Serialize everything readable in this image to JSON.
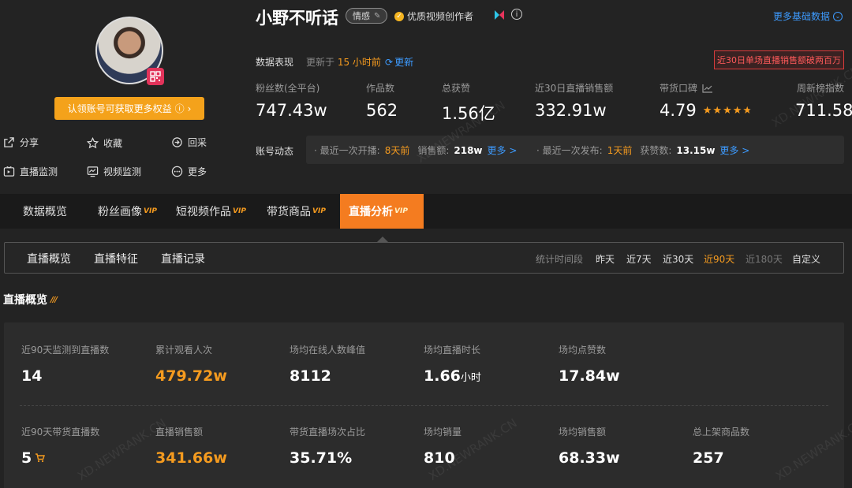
{
  "profile": {
    "name": "小野不听话",
    "tag": "情感",
    "creator_badge": "优质视频创作者",
    "more_basic_data": "更多基础数据",
    "claim_button": "认领账号可获取更多权益",
    "actions": [
      {
        "label": "分享",
        "icon": "share-icon"
      },
      {
        "label": "收藏",
        "icon": "star-outline-icon"
      },
      {
        "label": "回采",
        "icon": "refresh-icon"
      },
      {
        "label": "直播监测",
        "icon": "live-monitor-icon"
      },
      {
        "label": "视频监测",
        "icon": "video-monitor-icon"
      },
      {
        "label": "更多",
        "icon": "more-icon"
      }
    ]
  },
  "performance": {
    "label": "数据表现",
    "updated_prefix": "更新于",
    "updated_time": "15 小时前",
    "refresh": "更新",
    "alert": "近30日单场直播销售额破两百万",
    "stats": [
      {
        "label": "粉丝数(全平台)",
        "value": "747.43w"
      },
      {
        "label": "作品数",
        "value": "562"
      },
      {
        "label": "总获赞",
        "value": "1.56亿"
      },
      {
        "label": "近30日直播销售额",
        "value": "332.91w"
      },
      {
        "label": "带货口碑",
        "value": "4.79",
        "stars": 4.79
      },
      {
        "label": "周新榜指数",
        "value": "711.58"
      }
    ]
  },
  "dynamics": {
    "label": "账号动态",
    "live": {
      "prefix": "· 最近一次开播:",
      "time": "8天前",
      "metric_label": "销售额:",
      "metric_value": "218w",
      "more": "更多 >"
    },
    "post": {
      "prefix": "· 最近一次发布:",
      "time": "1天前",
      "metric_label": "获赞数:",
      "metric_value": "13.15w",
      "more": "更多 >"
    }
  },
  "tabs": [
    {
      "label": "数据概览",
      "vip": ""
    },
    {
      "label": "粉丝画像",
      "vip": "VIP"
    },
    {
      "label": "短视频作品",
      "vip": "VIP"
    },
    {
      "label": "带货商品",
      "vip": "VIP"
    },
    {
      "label": "直播分析",
      "vip": "VIP",
      "active": true
    }
  ],
  "subtabs": [
    "直播概览",
    "直播特征",
    "直播记录"
  ],
  "periods": {
    "label": "统计时间段",
    "options": [
      {
        "label": "昨天",
        "state": "normal"
      },
      {
        "label": "近7天",
        "state": "normal"
      },
      {
        "label": "近30天",
        "state": "normal"
      },
      {
        "label": "近90天",
        "state": "active"
      },
      {
        "label": "近180天",
        "state": "disabled"
      },
      {
        "label": "自定义",
        "state": "normal"
      }
    ]
  },
  "overview": {
    "title": "直播概览",
    "row1": [
      {
        "label": "近90天监测到直播数",
        "value": "14"
      },
      {
        "label": "累计观看人次",
        "value": "479.72w",
        "highlight": true
      },
      {
        "label": "场均在线人数峰值",
        "value": "8112"
      },
      {
        "label": "场均直播时长",
        "value": "1.66",
        "unit": "小时"
      },
      {
        "label": "场均点赞数",
        "value": "17.84w"
      }
    ],
    "row2": [
      {
        "label": "近90天带货直播数",
        "value": "5",
        "icon": "cart-icon"
      },
      {
        "label": "直播销售额",
        "value": "341.66w",
        "highlight": true
      },
      {
        "label": "带货直播场次占比",
        "value": "35.71%"
      },
      {
        "label": "场均销量",
        "value": "810"
      },
      {
        "label": "场均销售额",
        "value": "68.33w"
      },
      {
        "label": "总上架商品数",
        "value": "257"
      }
    ]
  },
  "watermark": "XD.NEWRANK.CN",
  "colors": {
    "accent": "#f47c20",
    "link": "#3d9bff",
    "highlight": "#f59b1f",
    "alert": "#ff5a5a"
  }
}
